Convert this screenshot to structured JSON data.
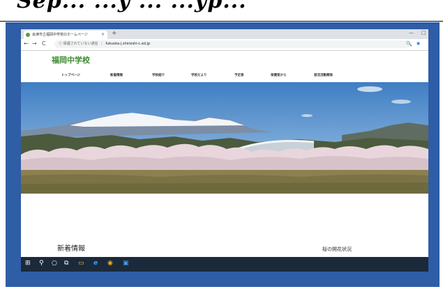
{
  "header_text": "Sep... ...y ... ...yp...",
  "browser": {
    "tab_title": "会津市立福岡中学校のホームページ",
    "tab_close": "×",
    "new_tab": "+",
    "minimize": "—",
    "close_window": "□",
    "back": "←",
    "forward": "→",
    "reload": "C",
    "info_icon": "ⓘ",
    "security_text": "保護されていない通信",
    "separator": "|",
    "url": "fukuoka-j.shiroishi-c.ed.jp",
    "search_icon": "🔍",
    "star_icon": "★"
  },
  "site": {
    "title": "福岡中学校",
    "nav": [
      "トップページ",
      "新着情報",
      "学校紹介",
      "学校だより",
      "予定表",
      "保健室から",
      "部活活動関係"
    ],
    "news_title": "新着情報",
    "sakura_title": "桜の開花状況"
  },
  "taskbar": {
    "items": [
      "⊞",
      "⚲",
      "○",
      "⧉",
      "▭",
      "e",
      "◉",
      "▣"
    ]
  },
  "colors": {
    "frame": "#2f5da6",
    "site_title": "#3d8b2f",
    "taskbar": "#1b2a3a"
  }
}
